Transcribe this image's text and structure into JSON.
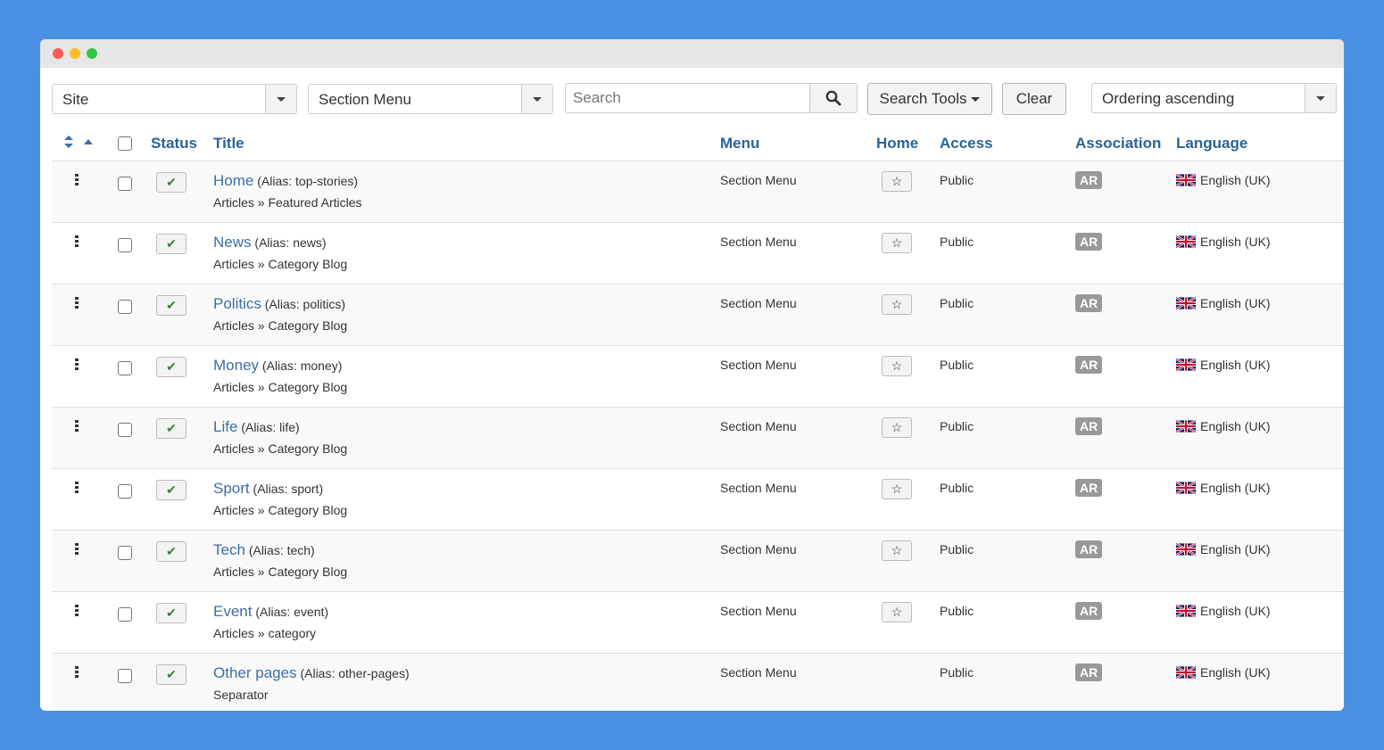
{
  "window": {
    "controls": [
      "close",
      "minimize",
      "maximize"
    ]
  },
  "toolbar": {
    "site_select": "Site",
    "menu_select": "Section Menu",
    "search_placeholder": "Search",
    "search_value": "",
    "search_tools_label": "Search Tools",
    "clear_label": "Clear",
    "ordering_select": "Ordering ascending"
  },
  "table": {
    "headers": {
      "status": "Status",
      "title": "Title",
      "menu": "Menu",
      "home": "Home",
      "access": "Access",
      "association": "Association",
      "language": "Language"
    },
    "rows": [
      {
        "title": "Home",
        "alias": "(Alias: top-stories)",
        "type": "Articles » Featured Articles",
        "menu": "Section Menu",
        "home": true,
        "access": "Public",
        "association": "AR",
        "language": "English (UK)"
      },
      {
        "title": "News",
        "alias": "(Alias: news)",
        "type": "Articles » Category Blog",
        "menu": "Section Menu",
        "home": true,
        "access": "Public",
        "association": "AR",
        "language": "English (UK)"
      },
      {
        "title": "Politics",
        "alias": "(Alias: politics)",
        "type": "Articles » Category Blog",
        "menu": "Section Menu",
        "home": true,
        "access": "Public",
        "association": "AR",
        "language": "English (UK)"
      },
      {
        "title": "Money",
        "alias": "(Alias: money)",
        "type": "Articles » Category Blog",
        "menu": "Section Menu",
        "home": true,
        "access": "Public",
        "association": "AR",
        "language": "English (UK)"
      },
      {
        "title": "Life",
        "alias": "(Alias: life)",
        "type": "Articles » Category Blog",
        "menu": "Section Menu",
        "home": true,
        "access": "Public",
        "association": "AR",
        "language": "English (UK)"
      },
      {
        "title": "Sport",
        "alias": "(Alias: sport)",
        "type": "Articles » Category Blog",
        "menu": "Section Menu",
        "home": true,
        "access": "Public",
        "association": "AR",
        "language": "English (UK)"
      },
      {
        "title": "Tech",
        "alias": "(Alias: tech)",
        "type": "Articles » Category Blog",
        "menu": "Section Menu",
        "home": true,
        "access": "Public",
        "association": "AR",
        "language": "English (UK)"
      },
      {
        "title": "Event",
        "alias": "(Alias: event)",
        "type": "Articles » category",
        "menu": "Section Menu",
        "home": true,
        "access": "Public",
        "association": "AR",
        "language": "English (UK)"
      },
      {
        "title": "Other pages",
        "alias": "(Alias: other-pages)",
        "type": "Separator",
        "menu": "Section Menu",
        "home": false,
        "access": "Public",
        "association": "AR",
        "language": "English (UK)"
      }
    ]
  }
}
